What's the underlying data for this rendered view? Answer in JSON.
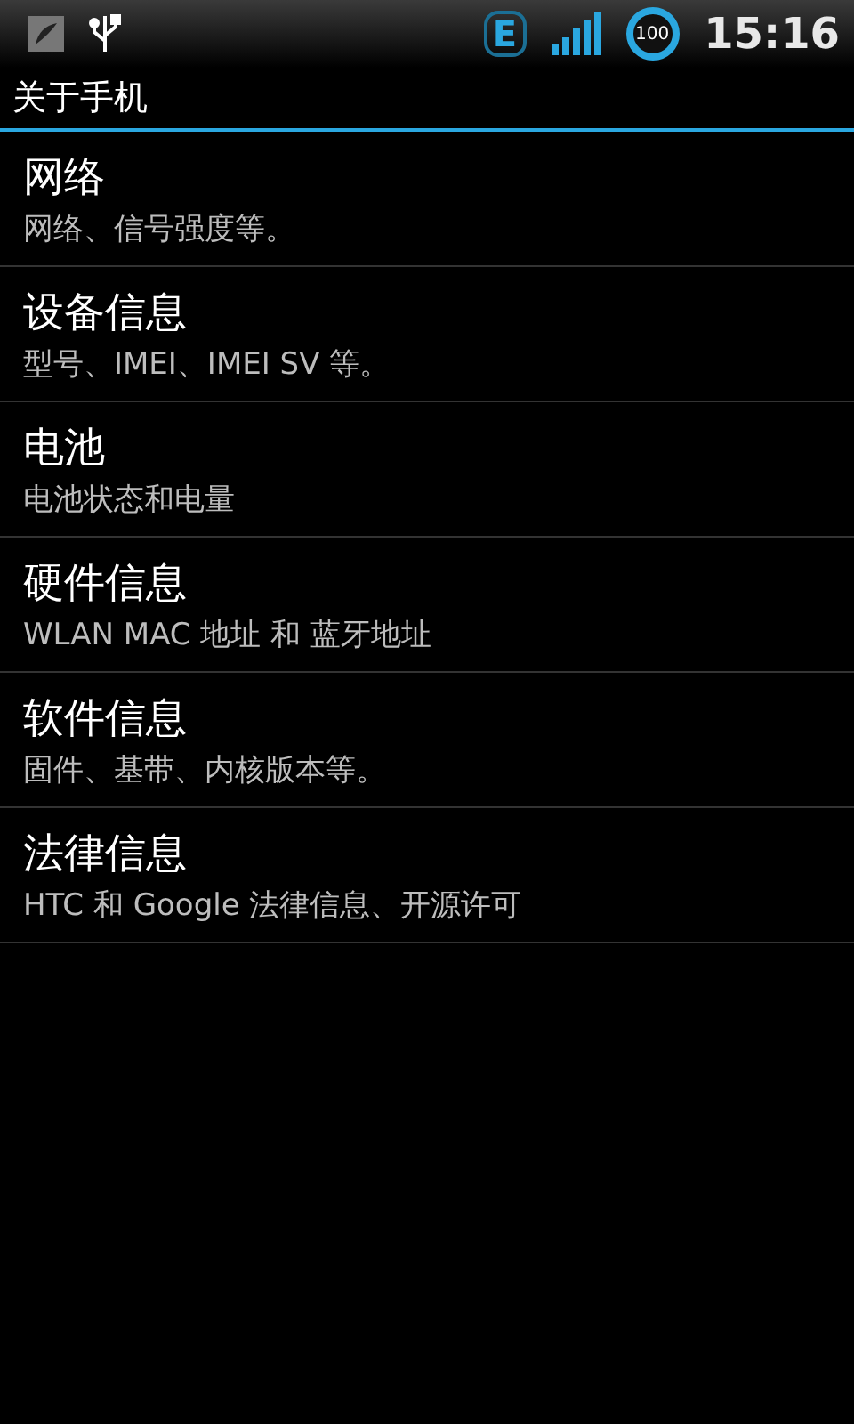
{
  "status_bar": {
    "network_type": "E",
    "battery": "100",
    "time": "15:16"
  },
  "header": {
    "title": "关于手机"
  },
  "items": [
    {
      "title": "网络",
      "subtitle": "网络、信号强度等。"
    },
    {
      "title": "设备信息",
      "subtitle": "型号、IMEI、IMEI SV 等。"
    },
    {
      "title": "电池",
      "subtitle": "电池状态和电量"
    },
    {
      "title": "硬件信息",
      "subtitle": "WLAN MAC 地址 和 蓝牙地址"
    },
    {
      "title": "软件信息",
      "subtitle": "固件、基带、内核版本等。"
    },
    {
      "title": "法律信息",
      "subtitle": "HTC 和 Google 法律信息、开源许可"
    }
  ]
}
